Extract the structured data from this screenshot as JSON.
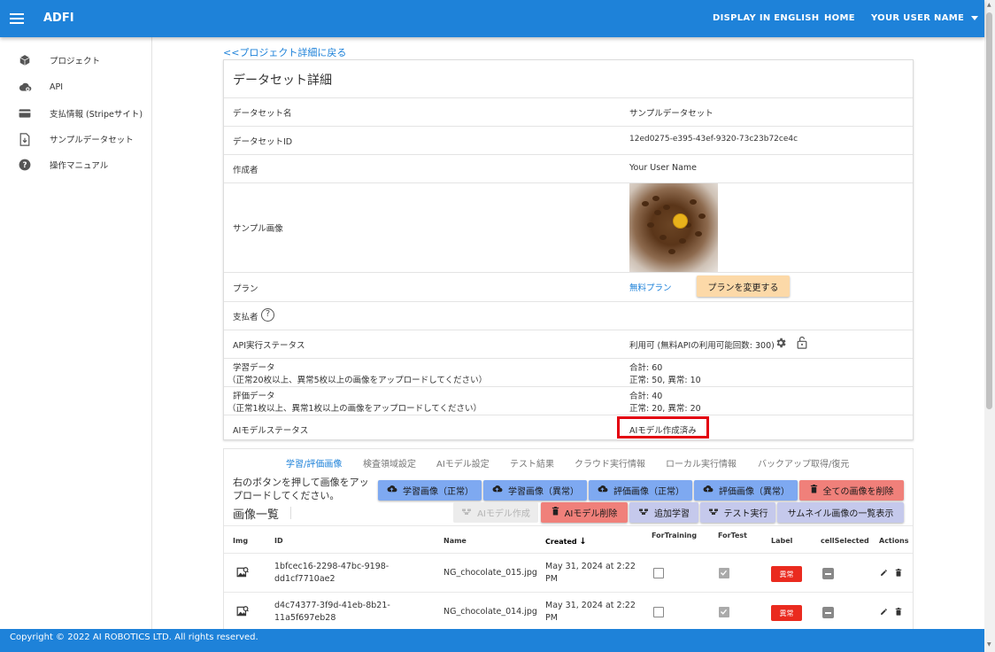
{
  "appbar": {
    "title": "ADFI",
    "english": "DISPLAY IN ENGLISH",
    "home": "HOME",
    "user": "YOUR USER NAME"
  },
  "sidebar": {
    "items": [
      {
        "label": "プロジェクト",
        "icon": "cube-icon"
      },
      {
        "label": "API",
        "icon": "cloud-icon"
      },
      {
        "label": "支払情報 (Stripeサイト)",
        "icon": "credit-card-icon"
      },
      {
        "label": "サンプルデータセット",
        "icon": "file-download-icon"
      },
      {
        "label": "操作マニュアル",
        "icon": "help-icon"
      }
    ]
  },
  "back_link": "<<プロジェクト詳細に戻る",
  "detail": {
    "title": "データセット詳細",
    "name_label": "データセット名",
    "name_value": "サンプルデータセット",
    "id_label": "データセットID",
    "id_value": "12ed0275-e395-43ef-9320-73c23b72ce4c",
    "creator_label": "作成者",
    "creator_value": "Your User Name",
    "image_label": "サンプル画像",
    "plan_label": "プラン",
    "plan_value": "無料プラン",
    "plan_button": "プランを変更する",
    "payer_label": "支払者",
    "api_label": "API実行ステータス",
    "api_value": "利用可 (無料APIの利用可能回数: 300)",
    "train_label": "学習データ",
    "train_note": "（正常20枚以上、異常5枚以上の画像をアップロードしてください）",
    "train_total": "合計: 60",
    "train_detail": "正常: 50, 異常: 10",
    "eval_label": "評価データ",
    "eval_note": "（正常1枚以上、異常1枚以上の画像をアップロードしてください）",
    "eval_total": "合計: 40",
    "eval_detail": "正常: 20, 異常: 20",
    "model_label": "AIモデルステータス",
    "model_value": "AIモデル作成済み"
  },
  "tabs": [
    "学習/評価画像",
    "検査領域設定",
    "AIモデル設定",
    "テスト結果",
    "クラウド実行情報",
    "ローカル実行情報",
    "バックアップ取得/復元"
  ],
  "upload_text": "右のボタンを押して画像をアップロードしてください。",
  "list_title": "画像一覧",
  "buttons": {
    "train_normal": "学習画像（正常）",
    "train_abnormal": "学習画像（異常）",
    "eval_normal": "評価画像（正常）",
    "eval_abnormal": "評価画像（異常）",
    "delete_all": "全ての画像を削除",
    "create_model": "AIモデル作成",
    "delete_model": "AIモデル削除",
    "additional_training": "追加学習",
    "test_run": "テスト実行",
    "thumbnail_list": "サムネイル画像の一覧表示"
  },
  "table": {
    "columns": [
      "Img",
      "ID",
      "Name",
      "Created",
      "ForTraining",
      "ForTest",
      "Label",
      "cellSelected",
      "Actions"
    ],
    "rows": [
      {
        "id1": "1bfcec16-2298-47bc-9198-",
        "id2": "dd1cf7710ae2",
        "name": "NG_chocolate_015.jpg",
        "created1": "May 31, 2024 at 2:22",
        "created2": "PM",
        "for_training": false,
        "for_test": true,
        "label": "異常"
      },
      {
        "id1": "d4c74377-3f9d-41eb-8b21-",
        "id2": "11a5f697eb28",
        "name": "NG_chocolate_014.jpg",
        "created1": "May 31, 2024 at 2:22",
        "created2": "PM",
        "for_training": false,
        "for_test": true,
        "label": "異常"
      }
    ]
  },
  "footer": "Copyright © 2022 AI ROBOTICS LTD. All rights reserved.",
  "colors": {
    "primary": "#1e82d9",
    "upload": "#7ea9f1",
    "danger": "#f0807a",
    "secondary": "#c5c9ec",
    "plan": "#fcd9a8",
    "highlight": "#e3000f"
  }
}
